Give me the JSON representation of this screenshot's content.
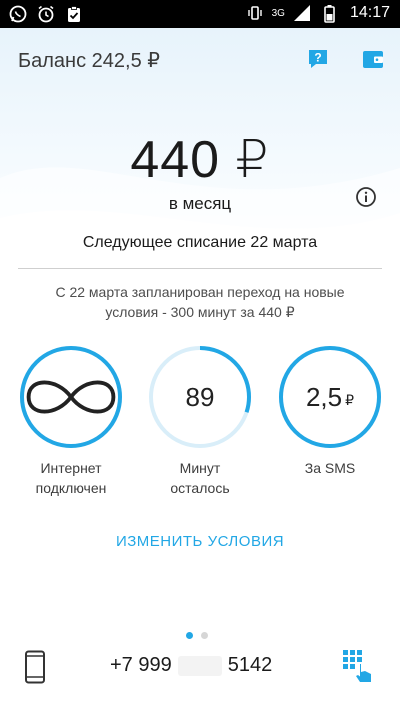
{
  "status_bar": {
    "left_icons": [
      "whatsapp-icon",
      "alarm-icon",
      "clipboard-check-icon"
    ],
    "network": "3G",
    "time": "14:17"
  },
  "header": {
    "balance": "Баланс 242,5 ₽",
    "icons": [
      "help-icon",
      "wallet-icon"
    ]
  },
  "tariff": {
    "price": "440 ₽",
    "period": "в месяц",
    "next_charge": "Следующее списание 22 марта",
    "notice": "С 22 марта запланирован переход на новые условия - 300 минут за 440 ₽"
  },
  "gauges": [
    {
      "value": "∞",
      "label_line1": "Интернет",
      "label_line2": "подключен",
      "fill": 1.0
    },
    {
      "value": "89",
      "label_line1": "Минут",
      "label_line2": "осталось",
      "fill": 0.3
    },
    {
      "value": "2,5",
      "unit": "₽",
      "label_line1": "За SMS",
      "label_line2": "",
      "fill": 1.0
    }
  ],
  "actions": {
    "change_conditions": "ИЗМЕНИТЬ УСЛОВИЯ"
  },
  "pager": {
    "pages": 2,
    "current": 1
  },
  "footer": {
    "phone_prefix": "+7 999",
    "phone_suffix": "5142"
  },
  "colors": {
    "accent": "#22a7e5",
    "track": "#d9eef9"
  }
}
